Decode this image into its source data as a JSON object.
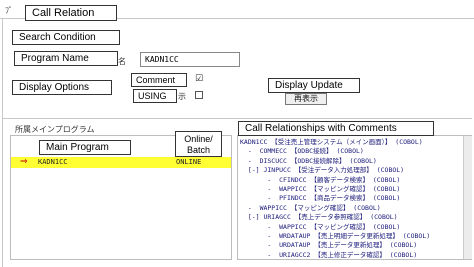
{
  "window": {
    "title_glyph": "ﾌﾟ"
  },
  "callouts": {
    "call_relation": "Call Relation",
    "search_condition": "Search Condition",
    "program_name": "Program Name",
    "display_options": "Display Options",
    "comment": "Comment",
    "using": "USING",
    "display_update": "Display Update",
    "main_program": "Main Program",
    "online_batch_line1": "Online/",
    "online_batch_line2": "Batch",
    "call_relationships": "Call Relationships with Comments"
  },
  "search": {
    "program_label_tail": "名",
    "program_value": "KADN1CC",
    "comment_checked": "☑",
    "using_tail": "示",
    "update_button": "再表示"
  },
  "main_panel": {
    "header": "所属メインプログラム",
    "selected_marker": "⇒",
    "program": "KADN1CC",
    "mode": "ONLINE"
  },
  "tree": {
    "rows": [
      "KADN1CC 【受注売上管理システム（メイン画面）】 (COBOL)",
      "  -  COMMECC 【ODBC接続】 (COBOL)",
      "  -  DISCUCC 【ODBC接続解除】 (COBOL)",
      "  [-] JINPUCC 【受注データ入力処理部】 (COBOL)",
      "       -  CFINDCC 【顧客データ検索】 (COBOL)",
      "       -  WAPPICC 【マッピング確認】 (COBOL)",
      "       -  PFINDCC 【商品データ検索】 (COBOL)",
      "  -  WAPPICC 【マッピング確認】 (COBOL)",
      "  [-] URIAGCC 【売上データ参照確認】 (COBOL)",
      "       -  WAPPICC 【マッピング確認】 (COBOL)",
      "       -  WRDATAUP 【売上明細データ更新処理】 (COBOL)",
      "       -  URDATAUP 【売上データ更新処理】 (COBOL)",
      "       -  URIAGCC2 【売上修正データ確認】 (COBOL)"
    ]
  },
  "colors": {
    "selection": "#ffff33",
    "tree_text": "#1a1a7a",
    "frame": "#c8c8c8"
  }
}
